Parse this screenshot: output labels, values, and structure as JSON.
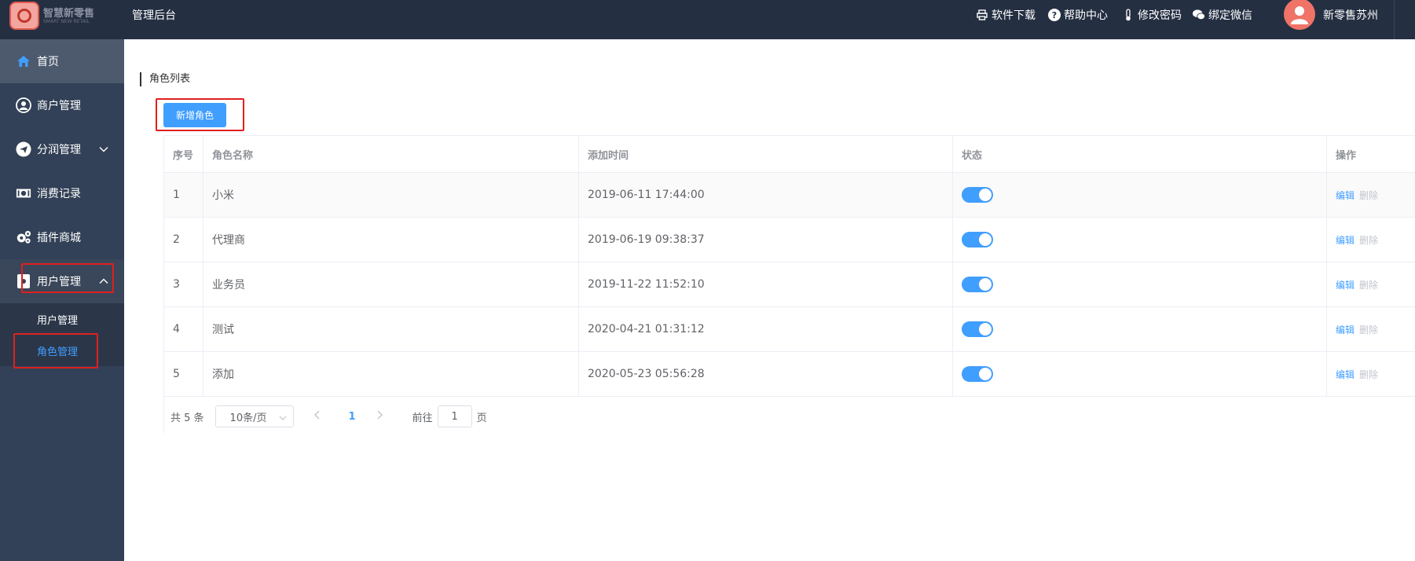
{
  "header": {
    "logo_text": "智慧新零售",
    "logo_sub": "SMART NEW RETAIL",
    "title": "管理后台",
    "links": [
      {
        "label": "软件下载",
        "icon": "printer-icon"
      },
      {
        "label": "帮助中心",
        "icon": "help-icon"
      },
      {
        "label": "修改密码",
        "icon": "thermometer-icon"
      },
      {
        "label": "绑定微信",
        "icon": "wechat-icon"
      }
    ],
    "username": "新零售苏州"
  },
  "sidebar": {
    "items": [
      {
        "label": "首页",
        "icon": "home-icon"
      },
      {
        "label": "商户管理",
        "icon": "user-circle-icon"
      },
      {
        "label": "分润管理",
        "icon": "send-icon"
      },
      {
        "label": "消费记录",
        "icon": "money-icon"
      },
      {
        "label": "插件商城",
        "icon": "cogs-icon"
      },
      {
        "label": "用户管理",
        "icon": "puzzle-icon"
      }
    ],
    "subitems": [
      {
        "label": "用户管理"
      },
      {
        "label": "角色管理"
      }
    ]
  },
  "main": {
    "title": "角色列表",
    "add_button": "新增角色",
    "columns": [
      "序号",
      "角色名称",
      "添加时间",
      "状态",
      "操作"
    ],
    "rows": [
      {
        "index": "1",
        "name": "小米",
        "time": "2019-06-11 17:44:00",
        "enabled": true
      },
      {
        "index": "2",
        "name": "代理商",
        "time": "2019-06-19 09:38:37",
        "enabled": true
      },
      {
        "index": "3",
        "name": "业务员",
        "time": "2019-11-22 11:52:10",
        "enabled": true
      },
      {
        "index": "4",
        "name": "测试",
        "time": "2020-04-21 01:31:12",
        "enabled": true
      },
      {
        "index": "5",
        "name": "添加",
        "time": "2020-05-23 05:56:28",
        "enabled": true
      }
    ],
    "actions": {
      "edit": "编辑",
      "delete": "删除"
    },
    "pagination": {
      "total": "共 5 条",
      "page_size": "10条/页",
      "current_page": "1",
      "goto_prefix": "前往",
      "goto_value": "1",
      "goto_suffix": "页"
    }
  },
  "colors": {
    "accent": "#409eff",
    "header_bg": "#242f42",
    "sidebar_bg": "#324157",
    "highlight": "#e02020"
  }
}
